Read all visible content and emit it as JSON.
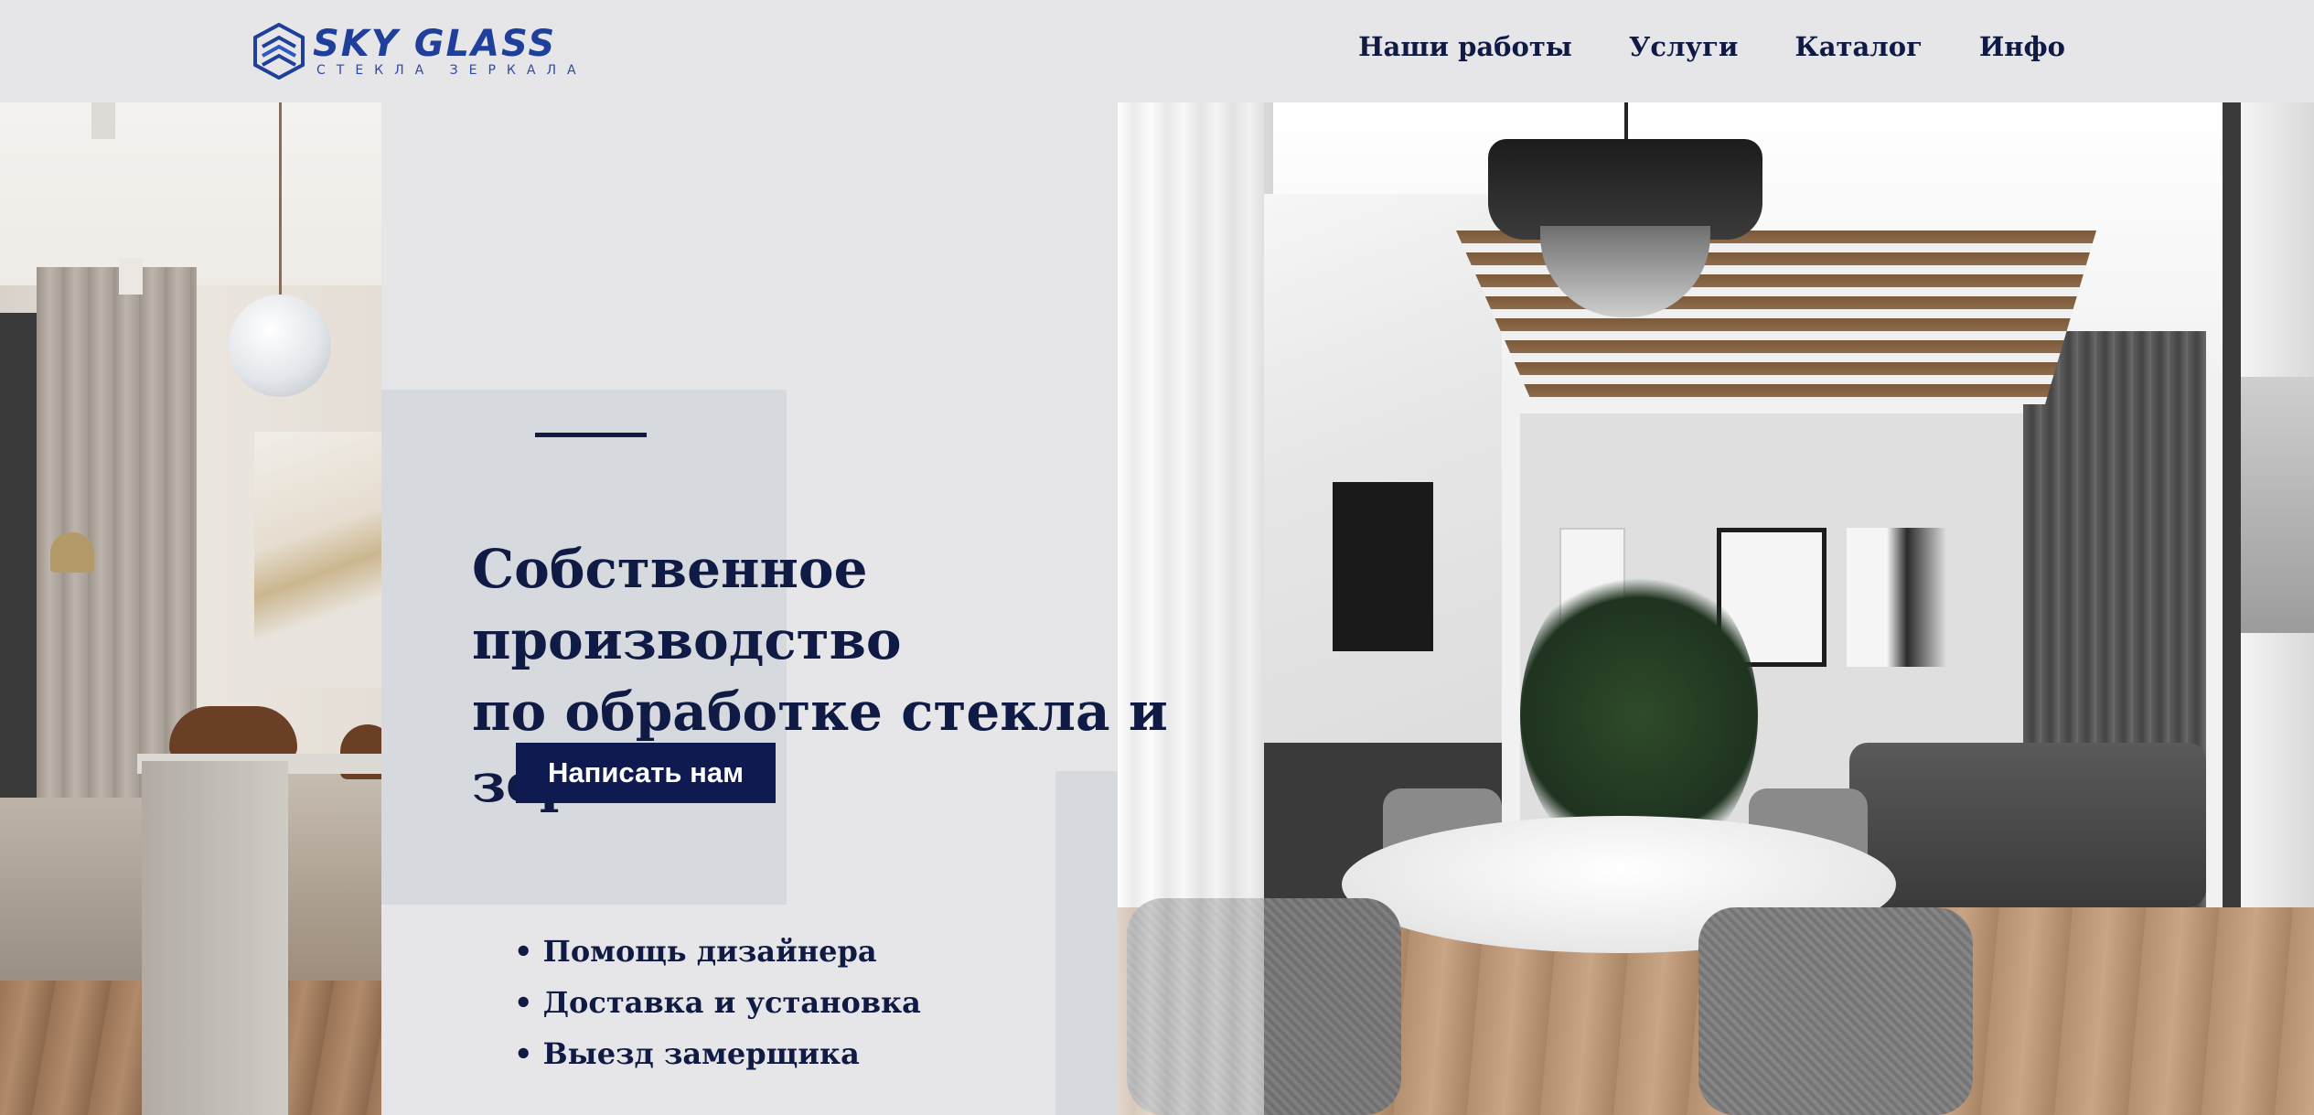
{
  "header": {
    "logo": {
      "name": "SKY GLASS",
      "tagline": "СТЕКЛА ЗЕРКАЛА"
    },
    "nav": [
      {
        "label": "Наши работы"
      },
      {
        "label": "Услуги"
      },
      {
        "label": "Каталог"
      },
      {
        "label": "Инфо"
      }
    ]
  },
  "hero": {
    "headline_line1": "Собственное производство",
    "headline_line2": "по обработке стекла и зеркал",
    "cta_label": "Написать нам",
    "bullets": [
      "Помощь дизайнера",
      "Доставка и установка",
      "Выезд замерщика"
    ]
  },
  "colors": {
    "navy": "#0f1a45",
    "logo_blue": "#1f3f9a",
    "accent_gray": "#d6d9de",
    "background": "#e6e6e8"
  }
}
